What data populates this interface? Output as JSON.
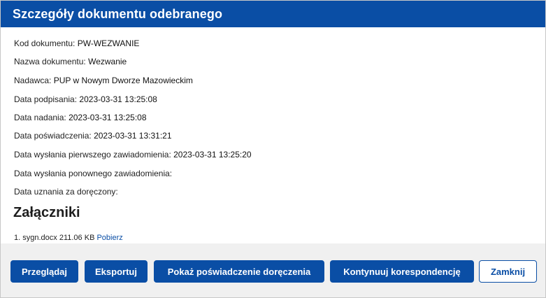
{
  "dialog": {
    "title": "Szczegóły dokumentu odebranego"
  },
  "details": [
    {
      "label": "Kod dokumentu:",
      "value": "PW-WEZWANIE"
    },
    {
      "label": "Nazwa dokumentu:",
      "value": "Wezwanie"
    },
    {
      "label": "Nadawca:",
      "value": "PUP w Nowym Dworze Mazowieckim"
    },
    {
      "label": "Data podpisania:",
      "value": "2023-03-31 13:25:08"
    },
    {
      "label": "Data nadania:",
      "value": "2023-03-31 13:25:08"
    },
    {
      "label": "Data poświadczenia:",
      "value": "2023-03-31 13:31:21"
    },
    {
      "label": "Data wysłania pierwszego zawiadomienia:",
      "value": "2023-03-31 13:25:20"
    },
    {
      "label": "Data wysłania ponownego zawiadomienia:",
      "value": ""
    },
    {
      "label": "Data uznania za doręczony:",
      "value": ""
    }
  ],
  "attachments": {
    "title": "Załączniki",
    "items": [
      {
        "index": "1.",
        "filename": "sygn.docx",
        "size": "211.06 KB",
        "link_label": "Pobierz"
      }
    ]
  },
  "buttons": {
    "browse": "Przeglądaj",
    "export": "Eksportuj",
    "show_certificate": "Pokaż poświadczenie doręczenia",
    "continue_correspondence": "Kontynuuj korespondencję",
    "close": "Zamknij"
  },
  "colors": {
    "accent": "#0a4ea5",
    "footer_bg": "#f0f0f0"
  }
}
